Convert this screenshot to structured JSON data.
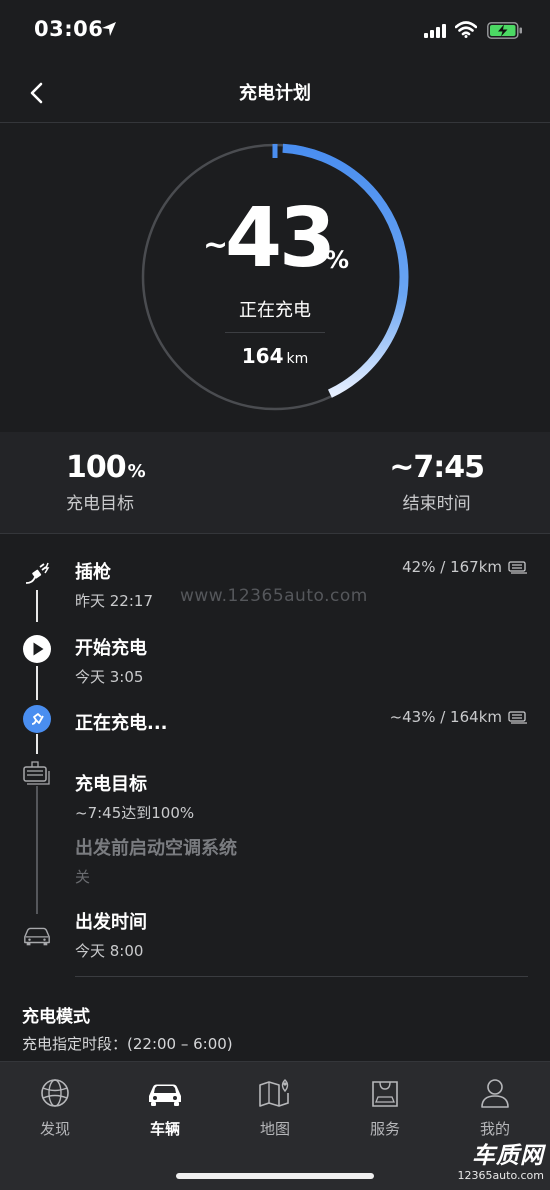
{
  "status_bar": {
    "time": "03:06"
  },
  "header": {
    "title": "充电计划"
  },
  "gauge": {
    "prefix": "~",
    "percent": "43",
    "percent_unit": "%",
    "status": "正在充电",
    "range_value": "164",
    "range_unit": "km",
    "fill_fraction": 0.43,
    "accent_color": "#4a8ef0"
  },
  "summary": {
    "target_value": "100",
    "target_unit": "%",
    "target_label": "充电目标",
    "end_time": "~7:45",
    "end_label": "结束时间"
  },
  "watermark": "www.12365auto.com",
  "timeline": [
    {
      "icon": "plug-icon",
      "title": "插枪",
      "subtitle": "昨天 22:17",
      "right": "42% / 167km",
      "right_icon": "battery-icon"
    },
    {
      "icon": "play-icon",
      "title": "开始充电",
      "subtitle": "今天 3:05"
    },
    {
      "icon": "charging-icon",
      "title": "正在充电...",
      "right": "~43% / 164km",
      "right_icon": "battery-icon"
    },
    {
      "icon": "charge-target-icon",
      "title": "充电目标",
      "subtitle": "~7:45达到100%"
    },
    {
      "icon": "",
      "title": "出发前启动空调系统",
      "subtitle": "关"
    },
    {
      "icon": "car-icon",
      "title": "出发时间",
      "subtitle": "今天 8:00"
    }
  ],
  "mode": {
    "title": "充电模式",
    "subtitle": "充电指定时段：(22:00 – 6:00)"
  },
  "tabs": [
    {
      "icon": "globe-icon",
      "label": "发现",
      "active": false
    },
    {
      "icon": "car-icon",
      "label": "车辆",
      "active": true
    },
    {
      "icon": "map-icon",
      "label": "地图",
      "active": false
    },
    {
      "icon": "shopping-bag-icon",
      "label": "服务",
      "active": false
    },
    {
      "icon": "person-icon",
      "label": "我的",
      "active": false
    }
  ],
  "brand": {
    "name": "车质网",
    "url": "12365auto.com"
  }
}
